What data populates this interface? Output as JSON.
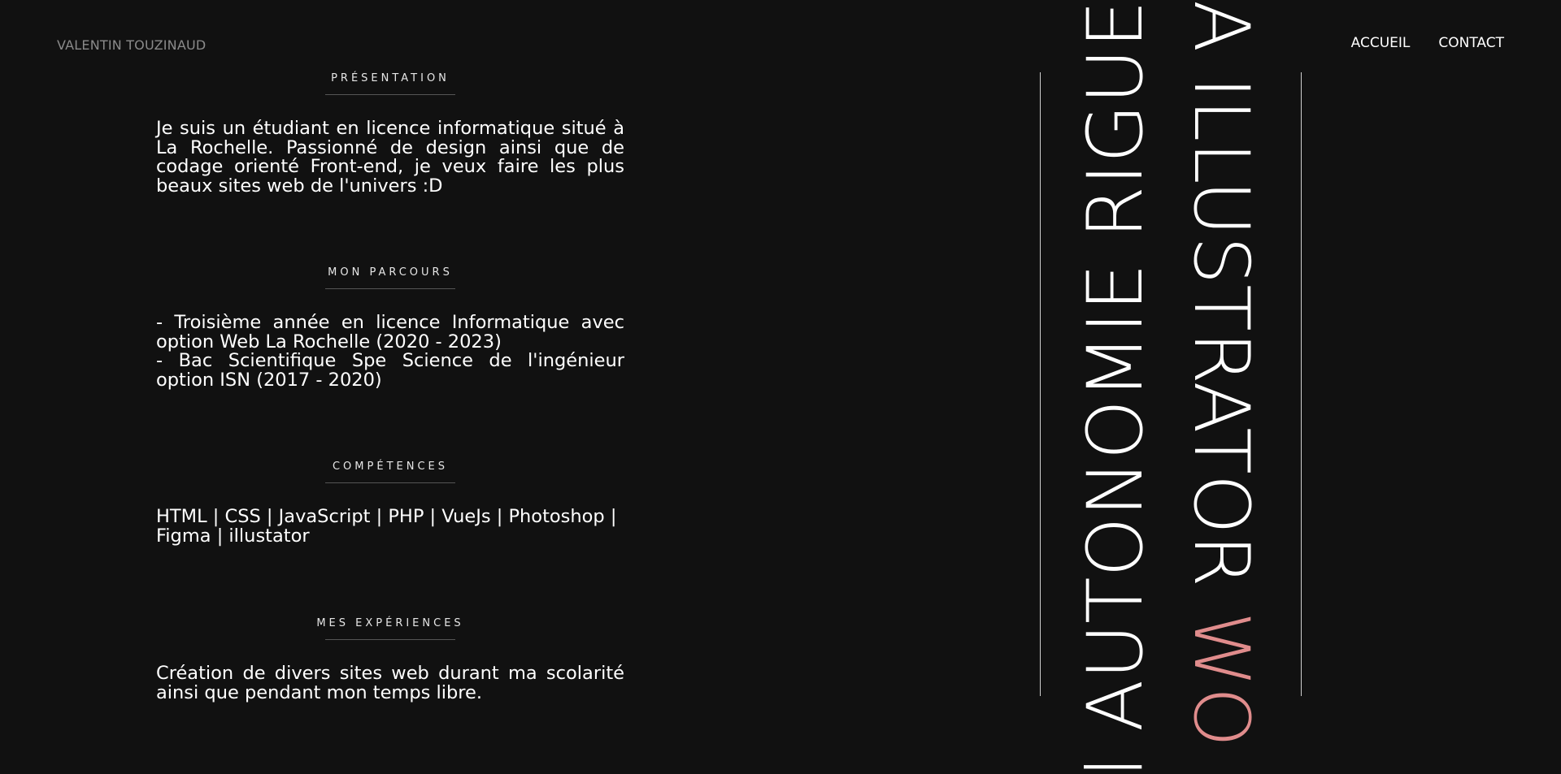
{
  "header": {
    "brand": "VALENTIN TOUZINAUD",
    "nav": [
      {
        "label": "ACCUEIL"
      },
      {
        "label": "CONTACT"
      }
    ]
  },
  "sections": [
    {
      "title": "PRÉSENTATION",
      "lines": [
        "Je suis un étudiant en licence informatique situé à La Rochelle. Passionné de design ainsi que de codage orienté Front-end, je veux faire les plus beaux sites web de l'univers :D"
      ]
    },
    {
      "title": "MON PARCOURS",
      "lines": [
        "- Troisième année en licence Informatique avec option Web La Rochelle (2020 - 2023)",
        "- Bac Scientifique Spe Science de l'ingénieur option ISN (2017 - 2020)"
      ]
    },
    {
      "title": "COMPÉTENCES",
      "lines": [
        "HTML | CSS | JavaScript | PHP | VueJs | Photoshop | Figma | illustator"
      ]
    },
    {
      "title": "MES EXPÉRIENCES",
      "lines": [
        "Création de divers sites web durant ma scolarité ainsi que pendant mon temps libre."
      ]
    }
  ],
  "marquee": {
    "left_text": "l AUTONOMIE RIGUE",
    "right_text": "A ILLUSTRATOR",
    "right_accent": " WO",
    "accent_color": "#e08c8c"
  }
}
